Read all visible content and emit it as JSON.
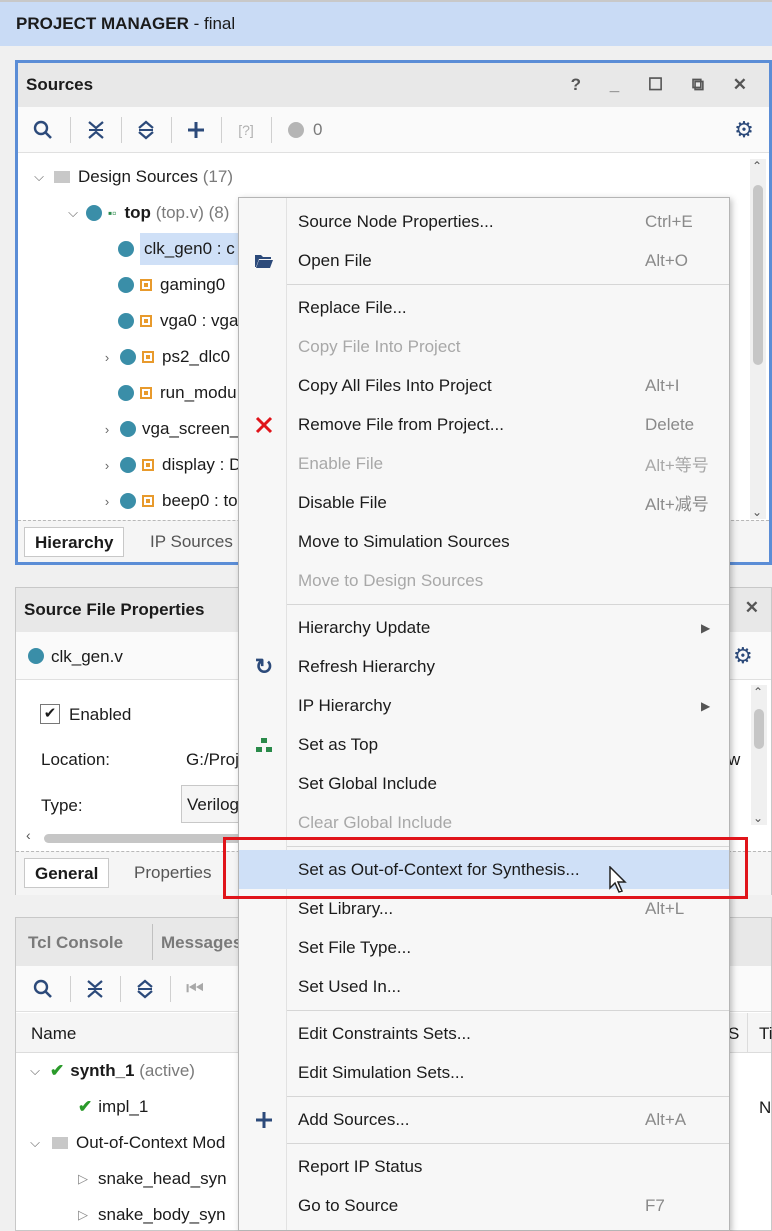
{
  "header": {
    "title": "PROJECT MANAGER",
    "suffix": " - final"
  },
  "sources": {
    "title": "Sources",
    "window_controls": "? _ ☐ ⧉ ✕",
    "toolbar": {
      "count": "0"
    },
    "tree": [
      {
        "label": "Design Sources",
        "extra": "(17)"
      },
      {
        "label": "top",
        "extra": "(top.v) (8)"
      },
      {
        "label": "clk_gen0 : c"
      },
      {
        "label": "gaming0"
      },
      {
        "label": "vga0 : vga"
      },
      {
        "label": "ps2_dlc0"
      },
      {
        "label": "run_modu"
      },
      {
        "label": "vga_screen_"
      },
      {
        "label": "display : D"
      },
      {
        "label": "beep0 : to"
      }
    ],
    "tabs": [
      "Hierarchy",
      "IP Sources"
    ]
  },
  "props": {
    "title": "Source File Properties",
    "file": "clk_gen.v",
    "enabled_label": "Enabled",
    "location_label": "Location:",
    "location_value": "G:/Proj",
    "location_tail": "w",
    "type_label": "Type:",
    "type_value": "Verilog",
    "tabs": [
      "General",
      "Properties"
    ]
  },
  "console": {
    "tabs": [
      "Tcl Console",
      "Messages"
    ],
    "columns": [
      "Name",
      "S",
      "Ti"
    ],
    "rows": [
      {
        "label": "synth_1",
        "extra": "(active)"
      },
      {
        "label": "impl_1",
        "tail": "N"
      },
      {
        "label": "Out-of-Context Mod"
      },
      {
        "label": "snake_head_syn"
      },
      {
        "label": "snake_body_syn"
      }
    ]
  },
  "menu": {
    "items": [
      {
        "label": "Source Node Properties...",
        "shortcut": "Ctrl+E"
      },
      {
        "label": "Open File",
        "shortcut": "Alt+O",
        "icon": "folder-open-icon"
      },
      {
        "label": "Replace File..."
      },
      {
        "label": "Copy File Into Project",
        "disabled": true
      },
      {
        "label": "Copy All Files Into Project",
        "shortcut": "Alt+I"
      },
      {
        "label": "Remove File from Project...",
        "shortcut": "Delete",
        "icon": "remove-x-icon"
      },
      {
        "label": "Enable File",
        "shortcut": "Alt+等号",
        "disabled": true
      },
      {
        "label": "Disable File",
        "shortcut": "Alt+减号"
      },
      {
        "label": "Move to Simulation Sources"
      },
      {
        "label": "Move to Design Sources",
        "disabled": true
      },
      {
        "label": "Hierarchy Update",
        "submenu": true
      },
      {
        "label": "Refresh Hierarchy",
        "icon": "refresh-icon"
      },
      {
        "label": "IP Hierarchy",
        "submenu": true
      },
      {
        "label": "Set as Top",
        "icon": "hierarchy-icon"
      },
      {
        "label": "Set Global Include"
      },
      {
        "label": "Clear Global Include",
        "disabled": true
      },
      {
        "label": "Set as Out-of-Context for Synthesis...",
        "highlighted": true
      },
      {
        "label": "Set Library...",
        "shortcut": "Alt+L"
      },
      {
        "label": "Set File Type..."
      },
      {
        "label": "Set Used In..."
      },
      {
        "label": "Edit Constraints Sets..."
      },
      {
        "label": "Edit Simulation Sets..."
      },
      {
        "label": "Add Sources...",
        "shortcut": "Alt+A",
        "icon": "plus-icon"
      },
      {
        "label": "Report IP Status"
      },
      {
        "label": "Go to Source",
        "shortcut": "F7"
      }
    ]
  }
}
